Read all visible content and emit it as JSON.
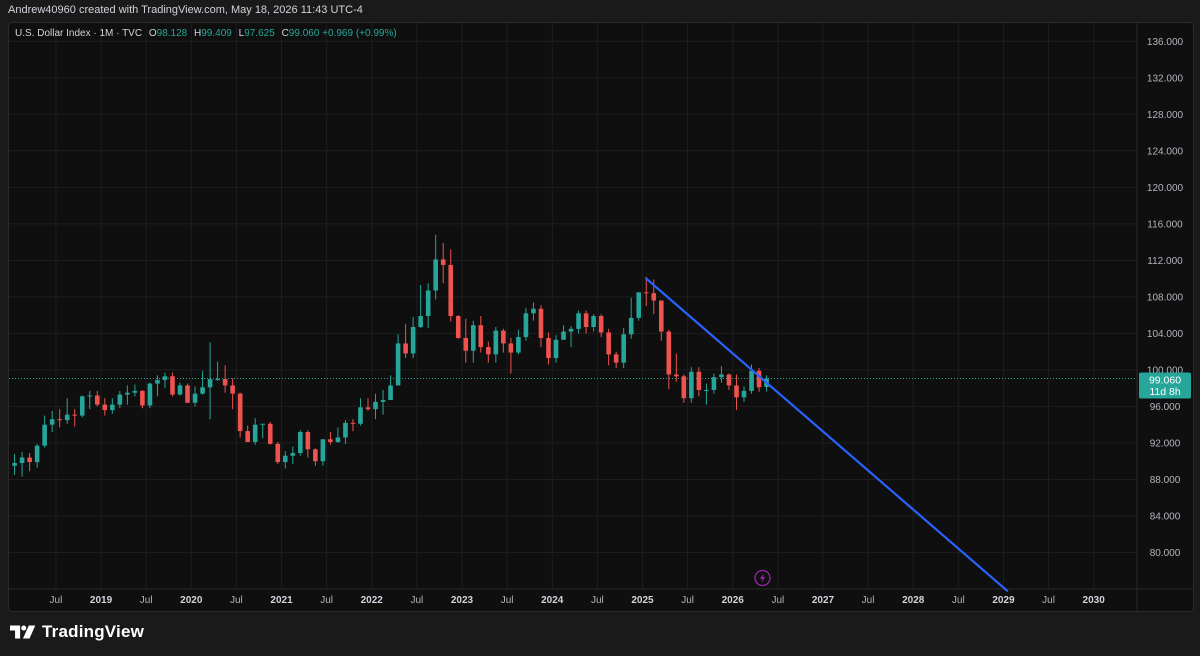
{
  "header": {
    "credit": "Andrew40960 created with TradingView.com, May 18, 2026 11:43 UTC-4"
  },
  "legend": {
    "symbol": "U.S. Dollar Index · 1M · TVC",
    "open_label": "O",
    "open": "98.128",
    "high_label": "H",
    "high": "99.409",
    "low_label": "L",
    "low": "97.625",
    "close_label": "C",
    "close": "99.060",
    "change": "+0.969 (+0.99%)"
  },
  "price_badge": {
    "price": "99.060",
    "countdown": "11d 8h"
  },
  "footer": {
    "brand": "TradingView"
  },
  "colors": {
    "up": "#26a69a",
    "down": "#ef5350",
    "trendline": "#2962ff",
    "background": "#0f0f0f",
    "grid": "#1e1e1e",
    "axis_text": "#b2b5be",
    "price_line": "#26a69a",
    "lightning": "#9c27b0"
  },
  "icons": {
    "lightning": "lightning-bolt-icon",
    "logo": "tradingview-logo-icon"
  },
  "chart_data": {
    "type": "candlestick",
    "timeframe": "1M",
    "y_range": [
      76,
      138
    ],
    "y_ticks": [
      "136.000",
      "132.000",
      "128.000",
      "124.000",
      "120.000",
      "116.000",
      "112.000",
      "108.000",
      "104.000",
      "100.000",
      "96.000",
      "92.000",
      "88.000",
      "84.000",
      "80.000"
    ],
    "x_ticks": [
      {
        "t": 2018.5,
        "label": "Jul"
      },
      {
        "t": 2019.0,
        "label": "2019"
      },
      {
        "t": 2019.5,
        "label": "Jul"
      },
      {
        "t": 2020.0,
        "label": "2020"
      },
      {
        "t": 2020.5,
        "label": "Jul"
      },
      {
        "t": 2021.0,
        "label": "2021"
      },
      {
        "t": 2021.5,
        "label": "Jul"
      },
      {
        "t": 2022.0,
        "label": "2022"
      },
      {
        "t": 2022.5,
        "label": "Jul"
      },
      {
        "t": 2023.0,
        "label": "2023"
      },
      {
        "t": 2023.5,
        "label": "Jul"
      },
      {
        "t": 2024.0,
        "label": "2024"
      },
      {
        "t": 2024.5,
        "label": "Jul"
      },
      {
        "t": 2025.0,
        "label": "2025"
      },
      {
        "t": 2025.5,
        "label": "Jul"
      },
      {
        "t": 2026.0,
        "label": "2026"
      },
      {
        "t": 2026.5,
        "label": "Jul"
      },
      {
        "t": 2027.0,
        "label": "2027"
      },
      {
        "t": 2027.5,
        "label": "Jul"
      },
      {
        "t": 2028.0,
        "label": "2028"
      },
      {
        "t": 2028.5,
        "label": "Jul"
      },
      {
        "t": 2029.0,
        "label": "2029"
      },
      {
        "t": 2029.5,
        "label": "Jul"
      },
      {
        "t": 2030.0,
        "label": "2030"
      }
    ],
    "x_range": [
      2017.98,
      2030.48
    ],
    "current_price": 99.06,
    "trendline": {
      "from": [
        "2025-01",
        110.0
      ],
      "to": [
        "2029-01",
        75.8
      ]
    },
    "candles": [
      [
        "2018-01",
        89.5,
        90.8,
        88.5,
        89.8
      ],
      [
        "2018-02",
        89.8,
        91.0,
        88.3,
        90.4
      ],
      [
        "2018-03",
        90.4,
        90.9,
        88.9,
        89.9
      ],
      [
        "2018-04",
        89.9,
        91.9,
        89.3,
        91.7
      ],
      [
        "2018-05",
        91.7,
        95.0,
        91.5,
        94.0
      ],
      [
        "2018-06",
        94.0,
        95.5,
        93.2,
        94.6
      ],
      [
        "2018-07",
        94.6,
        95.7,
        93.7,
        94.5
      ],
      [
        "2018-08",
        94.5,
        96.9,
        94.1,
        95.1
      ],
      [
        "2018-09",
        95.1,
        95.7,
        93.8,
        95.0
      ],
      [
        "2018-10",
        95.0,
        97.2,
        94.8,
        97.1
      ],
      [
        "2018-11",
        97.1,
        97.7,
        95.7,
        97.2
      ],
      [
        "2018-12",
        97.2,
        97.7,
        96.0,
        96.2
      ],
      [
        "2019-01",
        96.2,
        96.9,
        95.0,
        95.6
      ],
      [
        "2019-02",
        95.6,
        96.9,
        95.2,
        96.2
      ],
      [
        "2019-03",
        96.2,
        97.7,
        95.8,
        97.3
      ],
      [
        "2019-04",
        97.3,
        98.3,
        96.2,
        97.5
      ],
      [
        "2019-05",
        97.5,
        98.4,
        97.1,
        97.7
      ],
      [
        "2019-06",
        97.7,
        97.8,
        95.8,
        96.1
      ],
      [
        "2019-07",
        96.1,
        98.6,
        95.8,
        98.5
      ],
      [
        "2019-08",
        98.5,
        99.4,
        97.1,
        98.9
      ],
      [
        "2019-09",
        98.9,
        99.7,
        98.0,
        99.3
      ],
      [
        "2019-10",
        99.3,
        99.7,
        97.1,
        97.3
      ],
      [
        "2019-11",
        97.3,
        98.6,
        97.2,
        98.3
      ],
      [
        "2019-12",
        98.3,
        98.5,
        96.4,
        96.4
      ],
      [
        "2020-01",
        96.4,
        98.2,
        96.0,
        97.4
      ],
      [
        "2020-02",
        97.4,
        99.9,
        97.3,
        98.1
      ],
      [
        "2020-03",
        98.1,
        103.0,
        94.6,
        99.0
      ],
      [
        "2020-04",
        99.0,
        100.9,
        98.8,
        99.0
      ],
      [
        "2020-05",
        99.0,
        100.5,
        97.5,
        98.3
      ],
      [
        "2020-06",
        98.3,
        99.1,
        95.7,
        97.4
      ],
      [
        "2020-07",
        97.4,
        97.5,
        92.6,
        93.3
      ],
      [
        "2020-08",
        93.3,
        93.9,
        92.1,
        92.1
      ],
      [
        "2020-09",
        92.1,
        94.7,
        91.8,
        94.0
      ],
      [
        "2020-10",
        94.0,
        94.1,
        92.5,
        94.1
      ],
      [
        "2020-11",
        94.1,
        94.3,
        91.8,
        91.9
      ],
      [
        "2020-12",
        91.9,
        92.1,
        89.7,
        89.9
      ],
      [
        "2021-01",
        89.9,
        91.1,
        89.2,
        90.6
      ],
      [
        "2021-02",
        90.6,
        91.6,
        89.7,
        90.9
      ],
      [
        "2021-03",
        90.9,
        93.4,
        90.6,
        93.2
      ],
      [
        "2021-04",
        93.2,
        93.4,
        90.4,
        91.3
      ],
      [
        "2021-05",
        91.3,
        91.4,
        89.5,
        90.0
      ],
      [
        "2021-06",
        90.0,
        92.4,
        89.5,
        92.4
      ],
      [
        "2021-07",
        92.4,
        93.2,
        91.8,
        92.1
      ],
      [
        "2021-08",
        92.1,
        93.7,
        92.0,
        92.6
      ],
      [
        "2021-09",
        92.6,
        94.5,
        91.9,
        94.2
      ],
      [
        "2021-10",
        94.2,
        94.6,
        93.3,
        94.1
      ],
      [
        "2021-11",
        94.1,
        96.9,
        93.9,
        95.9
      ],
      [
        "2021-12",
        95.9,
        96.9,
        95.5,
        95.7
      ],
      [
        "2022-01",
        95.7,
        97.4,
        94.6,
        96.5
      ],
      [
        "2022-02",
        96.5,
        97.8,
        95.1,
        96.7
      ],
      [
        "2022-03",
        96.7,
        99.4,
        97.2,
        98.3
      ],
      [
        "2022-04",
        98.3,
        103.9,
        98.3,
        102.9
      ],
      [
        "2022-05",
        102.9,
        105.0,
        101.3,
        101.8
      ],
      [
        "2022-06",
        101.8,
        105.8,
        101.3,
        104.7
      ],
      [
        "2022-07",
        104.7,
        109.3,
        104.6,
        105.9
      ],
      [
        "2022-08",
        105.9,
        109.5,
        104.6,
        108.7
      ],
      [
        "2022-09",
        108.7,
        114.8,
        107.7,
        112.1
      ],
      [
        "2022-10",
        112.1,
        113.9,
        109.5,
        111.5
      ],
      [
        "2022-11",
        111.5,
        113.2,
        105.3,
        105.9
      ],
      [
        "2022-12",
        105.9,
        106.0,
        103.4,
        103.5
      ],
      [
        "2023-01",
        103.5,
        105.6,
        100.8,
        102.1
      ],
      [
        "2023-02",
        102.1,
        105.4,
        100.8,
        104.9
      ],
      [
        "2023-03",
        104.9,
        105.9,
        101.9,
        102.5
      ],
      [
        "2023-04",
        102.5,
        103.1,
        100.8,
        101.7
      ],
      [
        "2023-05",
        101.7,
        104.7,
        100.8,
        104.3
      ],
      [
        "2023-06",
        104.3,
        104.5,
        101.9,
        102.9
      ],
      [
        "2023-07",
        102.9,
        103.5,
        99.6,
        101.9
      ],
      [
        "2023-08",
        101.9,
        104.4,
        101.7,
        103.6
      ],
      [
        "2023-09",
        103.6,
        106.8,
        103.2,
        106.2
      ],
      [
        "2023-10",
        106.2,
        107.4,
        105.4,
        106.7
      ],
      [
        "2023-11",
        106.7,
        107.1,
        102.5,
        103.5
      ],
      [
        "2023-12",
        103.5,
        104.1,
        100.6,
        101.3
      ],
      [
        "2024-01",
        101.3,
        103.8,
        100.8,
        103.3
      ],
      [
        "2024-02",
        103.3,
        104.9,
        103.4,
        104.2
      ],
      [
        "2024-03",
        104.2,
        104.8,
        102.5,
        104.5
      ],
      [
        "2024-04",
        104.5,
        106.5,
        104.0,
        106.2
      ],
      [
        "2024-05",
        106.2,
        106.5,
        104.0,
        104.7
      ],
      [
        "2024-06",
        104.7,
        106.1,
        104.2,
        105.9
      ],
      [
        "2024-07",
        105.9,
        106.1,
        103.6,
        104.1
      ],
      [
        "2024-08",
        104.1,
        104.5,
        100.5,
        101.7
      ],
      [
        "2024-09",
        101.7,
        102.0,
        100.2,
        100.8
      ],
      [
        "2024-10",
        100.8,
        104.6,
        100.2,
        103.9
      ],
      [
        "2024-11",
        103.9,
        107.9,
        103.4,
        105.7
      ],
      [
        "2024-12",
        105.7,
        108.5,
        105.4,
        108.5
      ],
      [
        "2025-01",
        108.5,
        110.2,
        107.0,
        108.4
      ],
      [
        "2025-02",
        108.4,
        109.9,
        106.1,
        107.6
      ],
      [
        "2025-03",
        107.6,
        107.6,
        103.2,
        104.2
      ],
      [
        "2025-04",
        104.2,
        104.4,
        97.9,
        99.5
      ],
      [
        "2025-05",
        99.5,
        101.8,
        98.7,
        99.3
      ],
      [
        "2025-06",
        99.3,
        99.5,
        96.4,
        96.9
      ],
      [
        "2025-07",
        96.9,
        100.3,
        96.4,
        99.8
      ],
      [
        "2025-08",
        99.8,
        100.3,
        97.1,
        97.8
      ],
      [
        "2025-09",
        97.8,
        98.5,
        96.2,
        97.8
      ],
      [
        "2025-10",
        97.8,
        99.6,
        97.4,
        99.2
      ],
      [
        "2025-11",
        99.2,
        100.4,
        98.6,
        99.5
      ],
      [
        "2025-12",
        99.5,
        99.6,
        97.8,
        98.3
      ],
      [
        "2026-01",
        98.3,
        99.5,
        95.6,
        97.0
      ],
      [
        "2026-02",
        97.0,
        98.2,
        96.5,
        97.7
      ],
      [
        "2026-03",
        97.7,
        100.6,
        97.4,
        99.9
      ],
      [
        "2026-04",
        99.9,
        100.2,
        97.6,
        98.1
      ],
      [
        "2026-05",
        98.128,
        99.409,
        97.625,
        99.06
      ]
    ]
  }
}
